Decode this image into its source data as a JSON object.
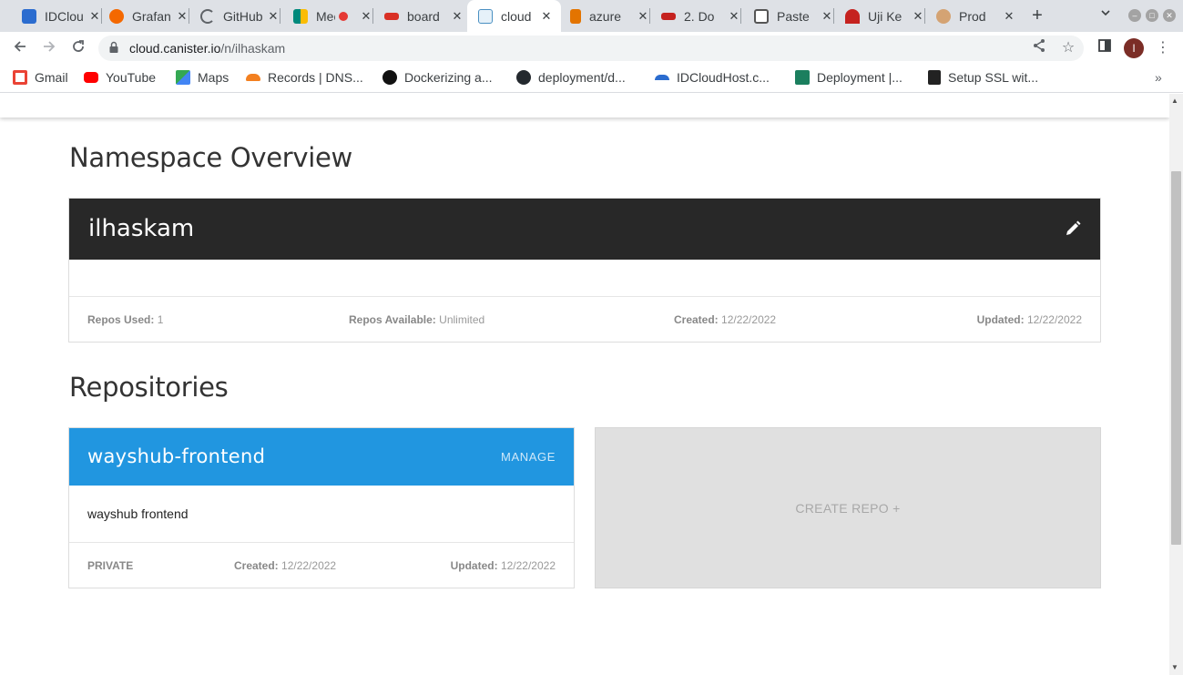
{
  "browser": {
    "tabs": [
      {
        "label": "IDCloudHost",
        "color": "#2b6ccf",
        "active": false
      },
      {
        "label": "Grafana",
        "color": "#f46800",
        "active": false
      },
      {
        "label": "GitHub",
        "color": "#5f6368",
        "active": false
      },
      {
        "label": "Meet",
        "color": "#00897b",
        "active": false
      },
      {
        "label": "board",
        "color": "#d93025",
        "active": false
      },
      {
        "label": "cloud",
        "color": "#4a90c2",
        "active": true
      },
      {
        "label": "azure",
        "color": "#e37400",
        "active": false
      },
      {
        "label": "2. Do",
        "color": "#c5221f",
        "active": false
      },
      {
        "label": "Paste",
        "color": "#555555",
        "active": false
      },
      {
        "label": "Uji Ke",
        "color": "#c5221f",
        "active": false
      },
      {
        "label": "Prod",
        "color": "#d4a373",
        "active": false
      }
    ],
    "url_host": "cloud.canister.io",
    "url_path": "/n/ilhaskam",
    "profile_initial": "I",
    "bookmarks": [
      {
        "label": "Gmail",
        "color": "#ea4335"
      },
      {
        "label": "YouTube",
        "color": "#ff0000"
      },
      {
        "label": "Maps",
        "color": "#34a853"
      },
      {
        "label": "Records | DNS...",
        "color": "#f38020"
      },
      {
        "label": "Dockerizing a...",
        "color": "#111111"
      },
      {
        "label": "deployment/d...",
        "color": "#24292e"
      },
      {
        "label": "IDCloudHost.c...",
        "color": "#2b6ccf"
      },
      {
        "label": "Deployment |...",
        "color": "#1b7f5e"
      },
      {
        "label": "Setup SSL wit...",
        "color": "#222222"
      }
    ]
  },
  "page": {
    "namespace_overview_title": "Namespace Overview",
    "namespace": {
      "name": "ilhaskam",
      "repos_used_label": "Repos Used:",
      "repos_used": "1",
      "repos_available_label": "Repos Available:",
      "repos_available": "Unlimited",
      "created_label": "Created:",
      "created": "12/22/2022",
      "updated_label": "Updated:",
      "updated": "12/22/2022"
    },
    "repositories_title": "Repositories",
    "repos": [
      {
        "name": "wayshub-frontend",
        "manage_label": "MANAGE",
        "description": "wayshub frontend",
        "visibility": "PRIVATE",
        "created_label": "Created:",
        "created": "12/22/2022",
        "updated_label": "Updated:",
        "updated": "12/22/2022"
      }
    ],
    "create_repo_label": "CREATE REPO +"
  }
}
